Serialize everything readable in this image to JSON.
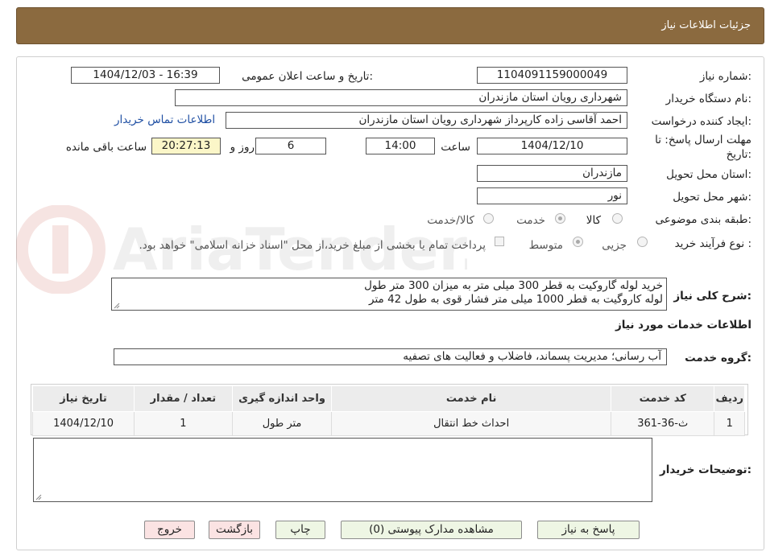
{
  "header": {
    "title": "جزئیات اطلاعات نیاز"
  },
  "form": {
    "need_number_label": "شماره نیاز:",
    "need_number": "1104091159000049",
    "announce_label": "تاریخ و ساعت اعلان عمومی:",
    "announce_value": "1404/12/03 - 16:39",
    "buyer_org_label": "نام دستگاه خریدار:",
    "buyer_org": "شهرداری رویان استان مازندران",
    "creator_label": "ایجاد کننده درخواست:",
    "creator": "احمد آقاسی زاده کارپرداز شهرداری رویان استان مازندران",
    "contact_link": "اطلاعات تماس خریدار",
    "deadline_label_1": "مهلت ارسال پاسخ: تا",
    "deadline_label_2": "تاریخ:",
    "deadline_date": "1404/12/10",
    "time_label": "ساعت",
    "deadline_time": "14:00",
    "days_value": "6",
    "days_label": "روز و",
    "remaining_time": "20:27:13",
    "remaining_label": "ساعت باقی مانده",
    "province_label": "استان محل تحویل:",
    "province": "مازندران",
    "city_label": "شهر محل تحویل:",
    "city": "نور",
    "category_label": "طبقه بندی موضوعی:",
    "category_options": [
      "کالا",
      "خدمت",
      "کالا/خدمت"
    ],
    "category_selected": "خدمت",
    "process_label": "نوع فرآیند خرید :",
    "process_options": [
      "جزیی",
      "متوسط"
    ],
    "process_selected": "متوسط",
    "treasury_note": "پرداخت تمام یا بخشی از مبلغ خرید،از محل \"اسناد خزانه اسلامی\" خواهد بود.",
    "description_label": "شرح کلی نیاز:",
    "description_line1": "خرید لوله گاروکیت به قطر 300 میلی متر به میزان 300 متر طول",
    "description_line2": "لوله  کاروگیت به قطر 1000 میلی متر فشار قوی به طول 42 متر"
  },
  "services": {
    "section_title": "اطلاعات خدمات مورد نیاز",
    "group_label": "گروه خدمت:",
    "group_value": "آب رسانی؛ مدیریت پسماند، فاضلاب و فعالیت های تصفیه",
    "columns": [
      "ردیف",
      "کد خدمت",
      "نام خدمت",
      "واحد اندازه گیری",
      "تعداد / مقدار",
      "تاریخ نیاز"
    ],
    "rows": [
      {
        "row": "1",
        "code": "ث-36-361",
        "name": "احداث خط انتقال",
        "unit": "متر طول",
        "qty": "1",
        "date": "1404/12/10"
      }
    ]
  },
  "buyer_notes_label": "توضیحات خریدار:",
  "buttons": {
    "reply": "پاسخ به نیاز",
    "attachments": "مشاهده مدارک پیوستی (0)",
    "print": "چاپ",
    "back": "بازگشت",
    "exit": "خروج"
  }
}
